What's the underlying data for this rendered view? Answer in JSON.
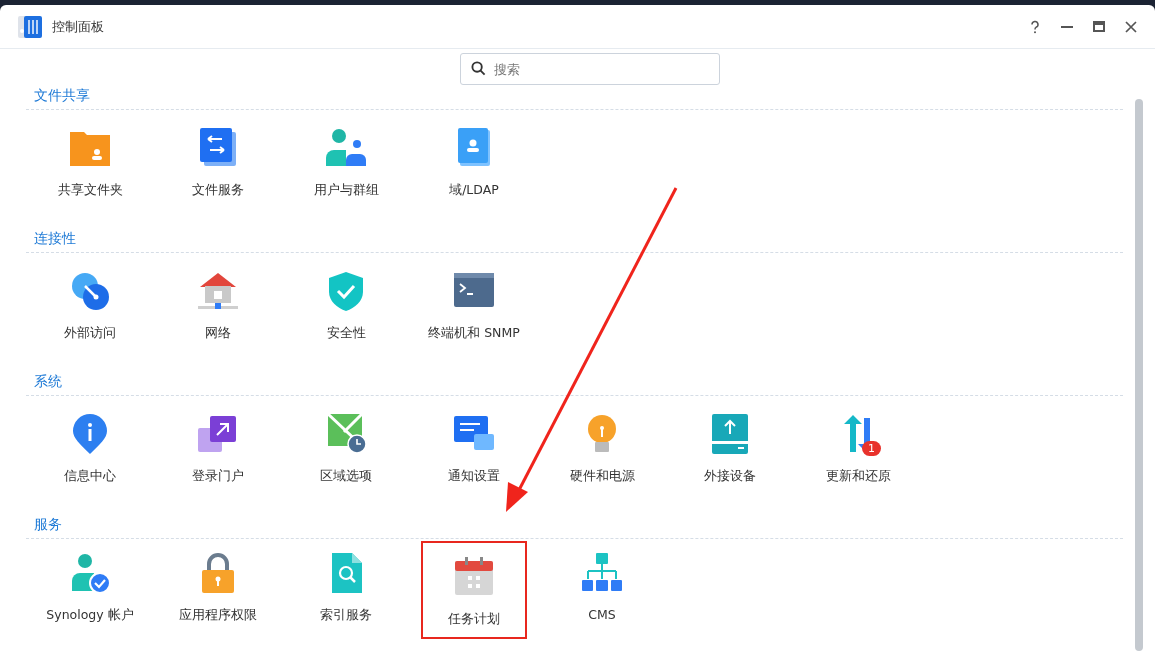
{
  "window": {
    "title": "控制面板"
  },
  "search": {
    "placeholder": "搜索"
  },
  "sections": [
    {
      "title": "文件共享",
      "items": [
        {
          "label": "共享文件夹",
          "highlighted": false
        },
        {
          "label": "文件服务",
          "highlighted": false
        },
        {
          "label": "用户与群组",
          "highlighted": false
        },
        {
          "label": "域/LDAP",
          "highlighted": false
        }
      ]
    },
    {
      "title": "连接性",
      "items": [
        {
          "label": "外部访问",
          "highlighted": false
        },
        {
          "label": "网络",
          "highlighted": false
        },
        {
          "label": "安全性",
          "highlighted": false
        },
        {
          "label": "终端机和 SNMP",
          "highlighted": false
        }
      ]
    },
    {
      "title": "系统",
      "items": [
        {
          "label": "信息中心",
          "highlighted": false
        },
        {
          "label": "登录门户",
          "highlighted": false
        },
        {
          "label": "区域选项",
          "highlighted": false
        },
        {
          "label": "通知设置",
          "highlighted": false
        },
        {
          "label": "硬件和电源",
          "highlighted": false
        },
        {
          "label": "外接设备",
          "highlighted": false
        },
        {
          "label": "更新和还原",
          "highlighted": false,
          "badge": "1"
        }
      ]
    },
    {
      "title": "服务",
      "items": [
        {
          "label": "Synology 帐户",
          "highlighted": false
        },
        {
          "label": "应用程序权限",
          "highlighted": false
        },
        {
          "label": "索引服务",
          "highlighted": false
        },
        {
          "label": "任务计划",
          "highlighted": true
        },
        {
          "label": "CMS",
          "highlighted": false
        }
      ]
    }
  ]
}
